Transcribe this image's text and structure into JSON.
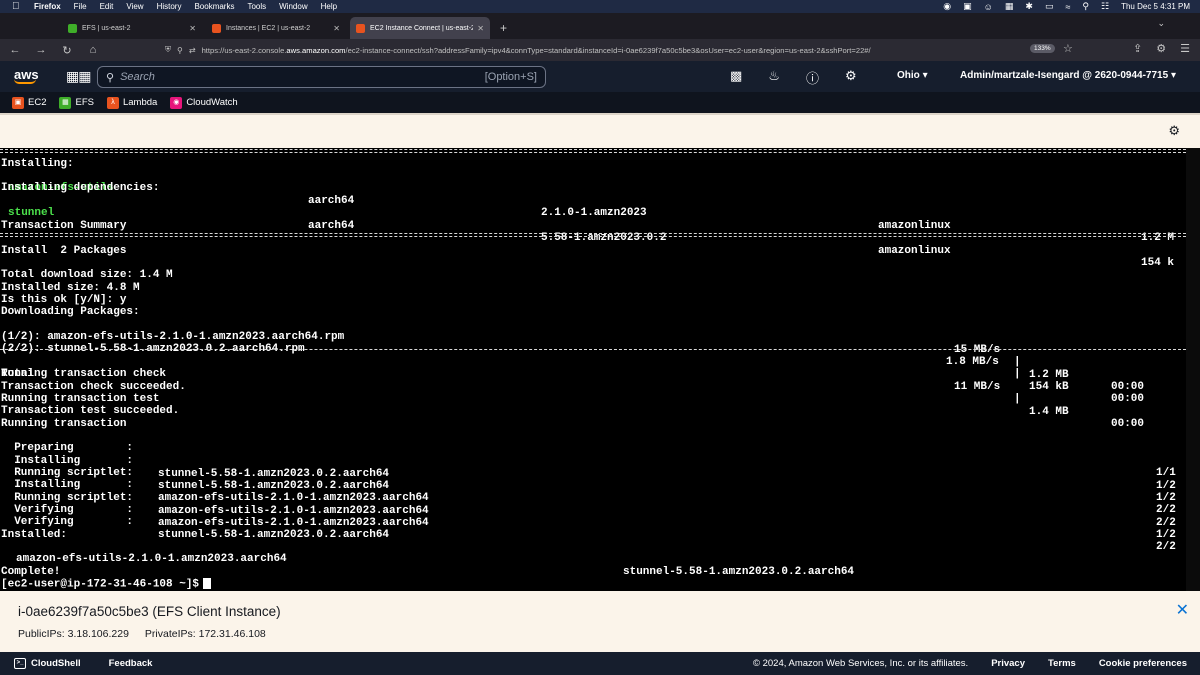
{
  "mac_bar": {
    "app": "Firefox",
    "menus": [
      "File",
      "Edit",
      "View",
      "History",
      "Bookmarks",
      "Tools",
      "Window",
      "Help"
    ],
    "datetime": "Thu Dec 5  4:31 PM"
  },
  "browser": {
    "tabs": [
      {
        "label": "EFS | us-east-2",
        "favicon_color": "#3fae29",
        "active": false
      },
      {
        "label": "Instances | EC2 | us-east-2",
        "favicon_color": "#e8531f",
        "active": false
      },
      {
        "label": "EC2 Instance Connect | us-east-2",
        "favicon_color": "#e8531f",
        "active": true
      }
    ],
    "url_prefix": "https://us-east-2.console.",
    "url_host": "aws.amazon.com",
    "url_path": "/ec2-instance-connect/ssh?addressFamily=ipv4&connType=standard&instanceId=i-0ae6239f7a50c5be3&osUser=ec2-user&region=us-east-2&sshPort=22#/",
    "zoom": "133%"
  },
  "aws_header": {
    "logo": "aws",
    "search_placeholder": "Search",
    "search_shortcut": "[Option+S]",
    "region": "Ohio",
    "account": "Admin/martzale-Isengard @ 2620-0944-7715"
  },
  "favorites": [
    {
      "label": "EC2",
      "color": "#e8531f"
    },
    {
      "label": "EFS",
      "color": "#3fae29"
    },
    {
      "label": "Lambda",
      "color": "#e8531f"
    },
    {
      "label": "CloudWatch",
      "color": "#e7157b"
    }
  ],
  "terminal": {
    "installing_header": "Installing:",
    "deps_header": "Installing dependencies:",
    "packages": [
      {
        "name": "amazon-efs-utils",
        "arch": "aarch64",
        "version": "2.1.0-1.amzn2023",
        "repo": "amazonlinux",
        "size": "1.2 M"
      },
      {
        "name": "stunnel",
        "arch": "aarch64",
        "version": "5.58-1.amzn2023.0.2",
        "repo": "amazonlinux",
        "size": "154 k"
      }
    ],
    "summary_header": "Transaction Summary",
    "install_count": "Install  2 Packages",
    "download_size": "Total download size: 1.4 M",
    "installed_size": "Installed size: 4.8 M",
    "confirm": "Is this ok [y/N]: y",
    "downloading": "Downloading Packages:",
    "downloads": [
      {
        "file": "(1/2): amazon-efs-utils-2.1.0-1.amzn2023.aarch64.rpm",
        "speed": "15 MB/s",
        "size": "1.2 MB",
        "time": "00:00"
      },
      {
        "file": "(2/2): stunnel-5.58-1.amzn2023.0.2.aarch64.rpm",
        "speed": "1.8 MB/s",
        "size": "154 kB",
        "time": "00:00"
      }
    ],
    "total": {
      "label": "Total",
      "speed": "11 MB/s",
      "size": "1.4 MB",
      "time": "00:00"
    },
    "steps": [
      "Running transaction check",
      "Transaction check succeeded.",
      "Running transaction test",
      "Transaction test succeeded.",
      "Running transaction"
    ],
    "actions": [
      {
        "action": "  Preparing        :",
        "pkg": "",
        "count": "1/1"
      },
      {
        "action": "  Installing       :",
        "pkg": "stunnel-5.58-1.amzn2023.0.2.aarch64",
        "count": "1/2"
      },
      {
        "action": "  Running scriptlet:",
        "pkg": "stunnel-5.58-1.amzn2023.0.2.aarch64",
        "count": "1/2"
      },
      {
        "action": "  Installing       :",
        "pkg": "amazon-efs-utils-2.1.0-1.amzn2023.aarch64",
        "count": "2/2"
      },
      {
        "action": "  Running scriptlet:",
        "pkg": "amazon-efs-utils-2.1.0-1.amzn2023.aarch64",
        "count": "2/2"
      },
      {
        "action": "  Verifying        :",
        "pkg": "amazon-efs-utils-2.1.0-1.amzn2023.aarch64",
        "count": "1/2"
      },
      {
        "action": "  Verifying        :",
        "pkg": "stunnel-5.58-1.amzn2023.0.2.aarch64",
        "count": "2/2"
      }
    ],
    "installed_header": "Installed:",
    "installed_pkgs": [
      "amazon-efs-utils-2.1.0-1.amzn2023.aarch64",
      "stunnel-5.58-1.amzn2023.0.2.aarch64"
    ],
    "complete": "Complete!",
    "prompt": "[ec2-user@ip-172-31-46-108 ~]$"
  },
  "instance": {
    "title": "i-0ae6239f7a50c5be3 (EFS Client Instance)",
    "public_ips": "PublicIPs: 3.18.106.229",
    "private_ips": "PrivateIPs: 172.31.46.108"
  },
  "footer": {
    "cloudshell": "CloudShell",
    "feedback": "Feedback",
    "copyright": "© 2024, Amazon Web Services, Inc. or its affiliates.",
    "privacy": "Privacy",
    "terms": "Terms",
    "cookies": "Cookie preferences"
  }
}
